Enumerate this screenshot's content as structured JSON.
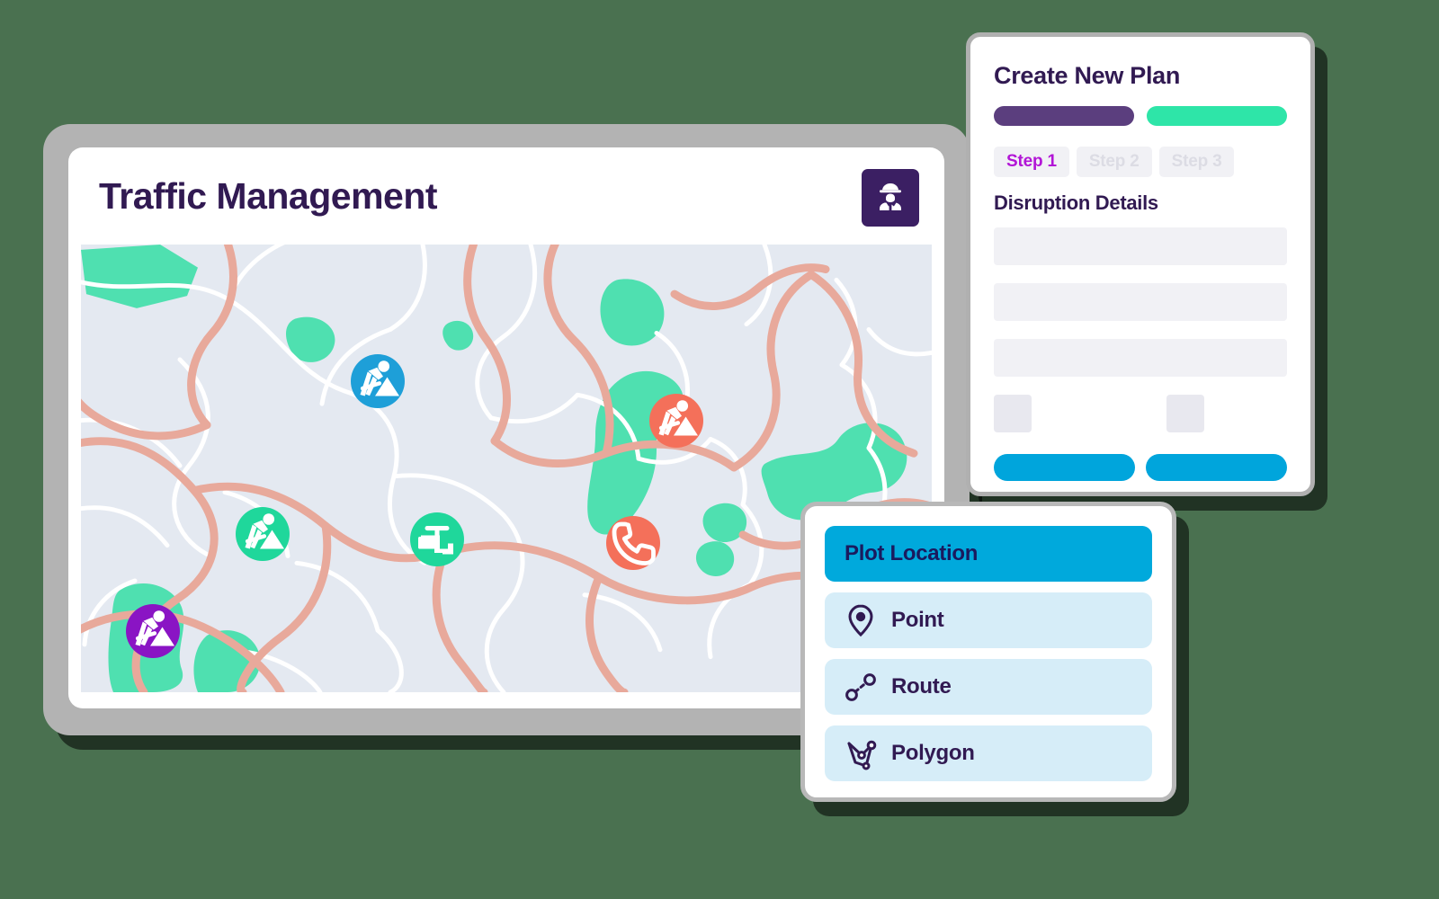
{
  "app": {
    "title": "Traffic Management",
    "avatar_icon": "construction-worker-icon"
  },
  "map": {
    "background_color": "#e4e9f1",
    "road_color": "#e8a99b",
    "minor_road_color": "#ffffff",
    "green_area_color": "#4fe0b0",
    "markers": [
      {
        "icon": "roadworks-icon",
        "color": "#1e9fd8",
        "label": "Roadworks"
      },
      {
        "icon": "roadworks-icon",
        "color": "#f4705a",
        "label": "Roadworks"
      },
      {
        "icon": "roadworks-icon",
        "color": "#1fd79b",
        "label": "Roadworks"
      },
      {
        "icon": "water-tap-icon",
        "color": "#1fd79b",
        "label": "Water Works"
      },
      {
        "icon": "phone-icon",
        "color": "#f4705a",
        "label": "Telecoms"
      },
      {
        "icon": "roadworks-icon",
        "color": "#8a14c4",
        "label": "Roadworks"
      }
    ]
  },
  "plan_panel": {
    "title": "Create New Plan",
    "bars": [
      {
        "color": "#5b3e7e"
      },
      {
        "color": "#2ee5a8"
      }
    ],
    "steps": [
      {
        "label": "Step 1",
        "active": true
      },
      {
        "label": "Step 2",
        "active": false
      },
      {
        "label": "Step 3",
        "active": false
      }
    ],
    "section_title": "Disruption Details",
    "fields": [
      {
        "value": "",
        "placeholder": ""
      },
      {
        "value": "",
        "placeholder": ""
      },
      {
        "value": "",
        "placeholder": ""
      }
    ],
    "checkboxes": [
      {
        "checked": false
      },
      {
        "checked": false
      }
    ],
    "buttons": [
      {
        "label": "",
        "color": "#00a5dc"
      },
      {
        "label": "",
        "color": "#00a5dc"
      }
    ]
  },
  "plot_panel": {
    "header": {
      "label": "Plot Location",
      "color": "#00a9dc"
    },
    "items": [
      {
        "label": "Point",
        "icon": "map-pin-icon"
      },
      {
        "label": "Route",
        "icon": "route-icon"
      },
      {
        "label": "Polygon",
        "icon": "polygon-icon"
      }
    ]
  },
  "theme": {
    "background": "#4a7150",
    "accent_purple": "#311a52",
    "accent_blue": "#00a9dc",
    "accent_green": "#2ee5a8",
    "accent_magenta": "#b215d6"
  }
}
